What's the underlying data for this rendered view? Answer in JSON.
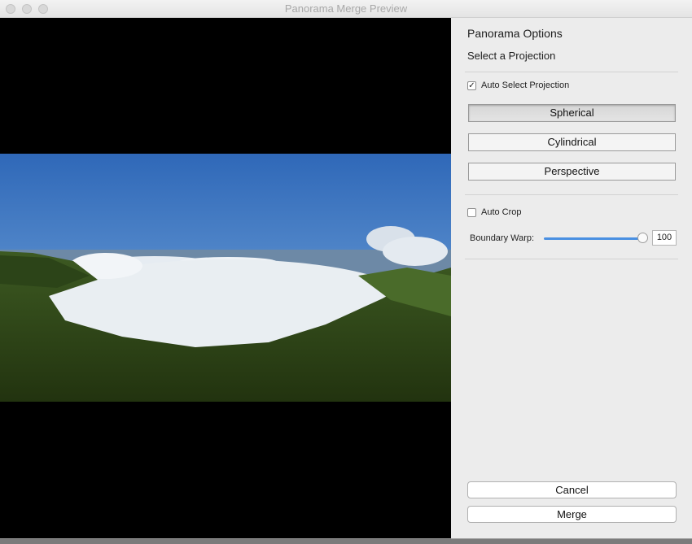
{
  "window": {
    "title": "Panorama Merge Preview"
  },
  "preview": {
    "image": "panorama-preview-image"
  },
  "options": {
    "heading": "Panorama Options",
    "subheading": "Select a Projection",
    "auto_select": {
      "label": "Auto Select Projection",
      "checked": true
    },
    "projections": [
      {
        "label": "Spherical",
        "selected": true
      },
      {
        "label": "Cylindrical",
        "selected": false
      },
      {
        "label": "Perspective",
        "selected": false
      }
    ],
    "auto_crop": {
      "label": "Auto Crop",
      "checked": false
    },
    "boundary_warp": {
      "label": "Boundary Warp:",
      "value": "100"
    }
  },
  "actions": {
    "cancel": "Cancel",
    "merge": "Merge"
  },
  "colors": {
    "accent": "#4a90e2"
  }
}
